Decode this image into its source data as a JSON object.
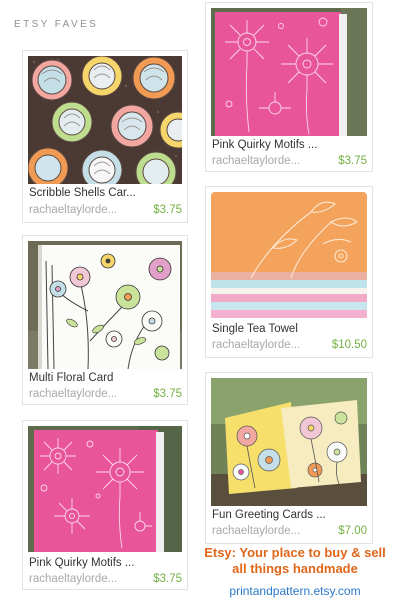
{
  "widget": {
    "heading": "ETSY FAVES",
    "tagline": "Etsy: Your place to buy & sell all things handmade",
    "shop_link": "printandpattern.etsy.com"
  },
  "items": [
    {
      "title": "Scribble Shells Car...",
      "shop": "rachaeltaylorde...",
      "price": "$3.75",
      "image": "scribble-shells-card"
    },
    {
      "title": "Multi Floral Card",
      "shop": "rachaeltaylorde...",
      "price": "$3.75",
      "image": "multi-floral-card"
    },
    {
      "title": "Pink Quirky Motifs ...",
      "shop": "rachaeltaylorde...",
      "price": "$3.75",
      "image": "pink-quirky-motifs-card"
    },
    {
      "title": "Pink Quirky Motifs ...",
      "shop": "rachaeltaylorde...",
      "price": "$3.75",
      "image": "pink-quirky-motifs-card"
    },
    {
      "title": "Single Tea Towel",
      "shop": "rachaeltaylorde...",
      "price": "$10.50",
      "image": "tea-towel-stack"
    },
    {
      "title": "Fun Greeting Cards ...",
      "shop": "rachaeltaylorde...",
      "price": "$7.00",
      "image": "greeting-cards-outdoor"
    }
  ],
  "colors": {
    "heading": "#8f8f8f",
    "price": "#72b043",
    "shop": "#a8a8a8",
    "tagline": "#e0671a",
    "link": "#2a79c9",
    "card_border": "#e3e3e3"
  }
}
